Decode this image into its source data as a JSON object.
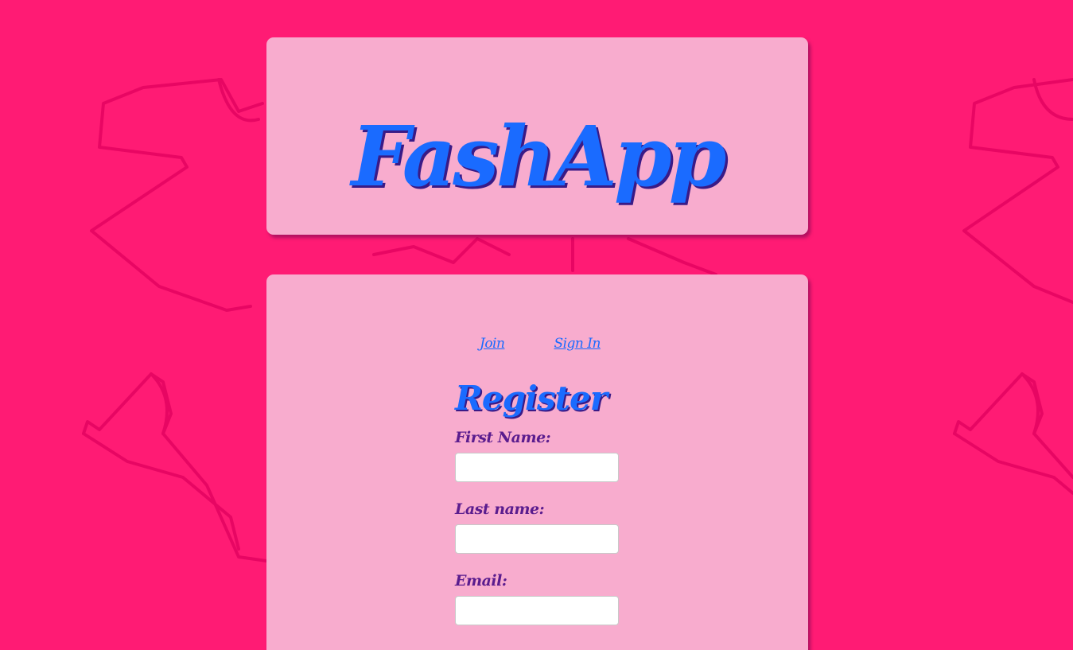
{
  "colors": {
    "background": "#ff1b74",
    "card": "#f8b2d2",
    "accent_blue": "#1a6bff",
    "label_purple": "#5a1c8e"
  },
  "header": {
    "logo_text": "FashApp"
  },
  "nav": {
    "join_label": "Join",
    "signin_label": "Sign In"
  },
  "form": {
    "title": "Register",
    "fields": [
      {
        "label": "First Name:",
        "value": ""
      },
      {
        "label": "Last name:",
        "value": ""
      },
      {
        "label": "Email:",
        "value": ""
      }
    ]
  }
}
